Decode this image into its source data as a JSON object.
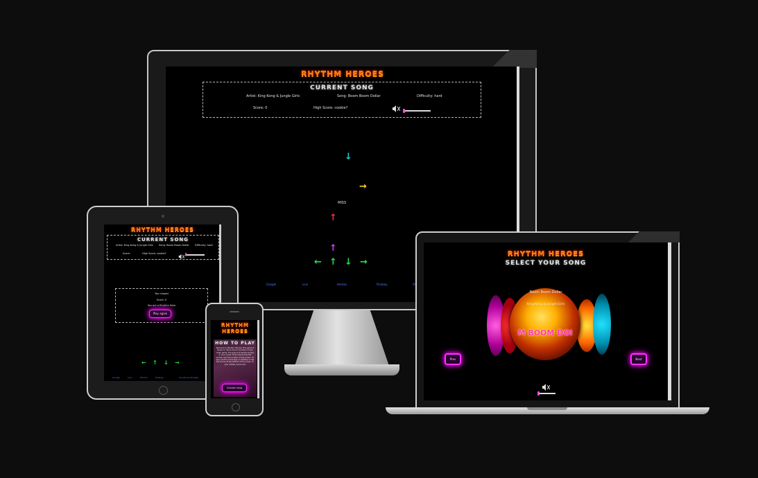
{
  "app_title": "RHYTHM HEROES",
  "desktop": {
    "panel_title": "CURRENT SONG",
    "artist": "Artist: King Kong & Jungle Girls",
    "song": "Song: Boom Boom Dollar",
    "difficulty": "Difficulty: hard",
    "score": "Score: 0",
    "high_score": "High Score: cookie?",
    "miss_text": "MISS",
    "volume_level": 0.0,
    "footer": [
      "Google",
      "Live",
      "Heroku",
      "Pixabay",
      "Shirl"
    ]
  },
  "tablet": {
    "panel_title": "CURRENT SONG",
    "artist": "Artist: King Kong & Jungle Girls",
    "song": "Song: Boom Boom Dollar",
    "difficulty": "Difficulty: hard",
    "score": "Score:",
    "high_score": "High Score: cookie?",
    "end_line1": "You missed",
    "end_line2": "Score: 0",
    "end_line3": "You are a Rhythm Hero",
    "play_again": "Play again",
    "footer": [
      "Google",
      "Live",
      "Heroku",
      "Pixabay",
      "Sounds by Pixabay"
    ]
  },
  "phone": {
    "section_title": "HOW TO PLAY",
    "body": "Welcome to Rhythm Heroes! This game is based on dance dance revolution music video game. The goal is to tap the arrows in your screen at the same time the arrows reach the bottom of the screen. To play use the arrow keys on desktop or tap the arrows at the bottom of the screen on your mobile. Good luck!",
    "choose_button": "Choose song"
  },
  "laptop": {
    "section_title": "SELECT YOUR SONG",
    "song_name": "Boom Boom Dollar",
    "artist_name": "King Kong & Jungle Girls",
    "cover_text": "M BOOM DOl",
    "prev_button": "Prev",
    "next_button": "Next",
    "volume_level": 0.0
  },
  "colors": {
    "title_orange": "#ff7a1a",
    "neon_pink": "#ff33ff",
    "arrow_cyan": "#19d2c8",
    "arrow_yellow": "#ffd21a",
    "arrow_red": "#ff2a3c",
    "arrow_purple": "#d23cff",
    "arrow_green": "#22e14a"
  },
  "icons": {
    "arrow_up": "↑",
    "arrow_down": "↓",
    "arrow_left": "←",
    "arrow_right": "→",
    "mute": "🔇"
  }
}
